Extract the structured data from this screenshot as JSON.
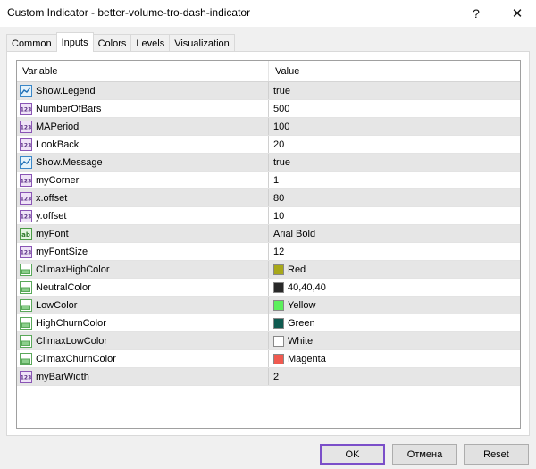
{
  "window": {
    "title": "Custom Indicator - better-volume-tro-dash-indicator",
    "help_glyph": "?",
    "close_glyph": "✕"
  },
  "tabs": [
    {
      "label": "Common"
    },
    {
      "label": "Inputs",
      "active": true
    },
    {
      "label": "Colors"
    },
    {
      "label": "Levels"
    },
    {
      "label": "Visualization"
    }
  ],
  "grid": {
    "headers": {
      "variable": "Variable",
      "value": "Value"
    },
    "rows": [
      {
        "name": "Show.Legend",
        "value": "true",
        "icon": "bool-icon"
      },
      {
        "name": "NumberOfBars",
        "value": "500",
        "icon": "int-icon"
      },
      {
        "name": "MAPeriod",
        "value": "100",
        "icon": "int-icon"
      },
      {
        "name": "LookBack",
        "value": "20",
        "icon": "int-icon"
      },
      {
        "name": "Show.Message",
        "value": "true",
        "icon": "bool-icon"
      },
      {
        "name": "myCorner",
        "value": "1",
        "icon": "int-icon"
      },
      {
        "name": "x.offset",
        "value": "80",
        "icon": "int-icon"
      },
      {
        "name": "y.offset",
        "value": "10",
        "icon": "int-icon"
      },
      {
        "name": "myFont",
        "value": "Arial Bold",
        "icon": "string-icon"
      },
      {
        "name": "myFontSize",
        "value": "12",
        "icon": "int-icon"
      },
      {
        "name": "ClimaxHighColor",
        "value": "Red",
        "icon": "color-icon",
        "swatch": "#a8a81a"
      },
      {
        "name": "NeutralColor",
        "value": "40,40,40",
        "icon": "color-icon",
        "swatch": "#282828"
      },
      {
        "name": "LowColor",
        "value": "Yellow",
        "icon": "color-icon",
        "swatch": "#5cf05c"
      },
      {
        "name": "HighChurnColor",
        "value": "Green",
        "icon": "color-icon",
        "swatch": "#0f5a50"
      },
      {
        "name": "ClimaxLowColor",
        "value": "White",
        "icon": "color-icon",
        "swatch": "#ffffff"
      },
      {
        "name": "ClimaxChurnColor",
        "value": "Magenta",
        "icon": "color-icon",
        "swatch": "#f05a50"
      },
      {
        "name": "myBarWidth",
        "value": "2",
        "icon": "int-icon"
      }
    ]
  },
  "buttons": {
    "ok": "OK",
    "cancel": "Отмена",
    "reset": "Reset"
  },
  "colors": {
    "accent": "#7b4fc9",
    "row_alt": "#e6e6e6"
  }
}
